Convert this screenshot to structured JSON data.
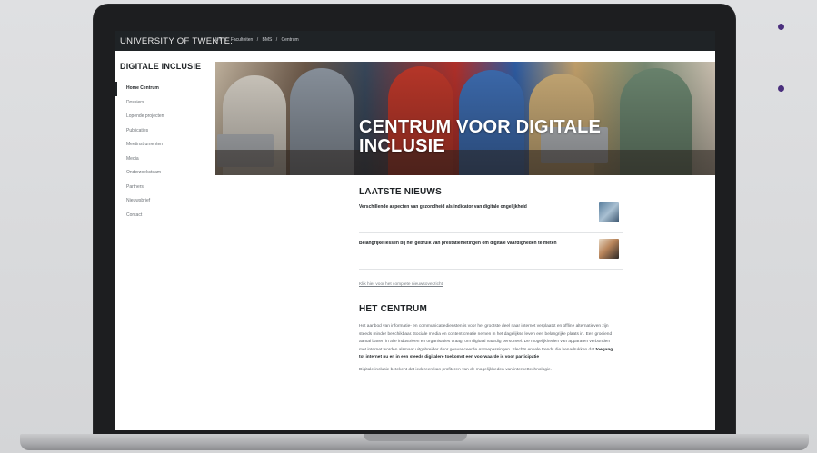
{
  "site": {
    "brand": "UNIVERSITY OF TWENTE.",
    "breadcrumbs": [
      "UT",
      "/",
      "Faculteiten",
      "/",
      "BMS",
      "/",
      "Centrum"
    ]
  },
  "sidebar": {
    "title": "DIGITALE INCLUSIE",
    "items": [
      {
        "label": "Home Centrum"
      },
      {
        "label": "Dossiers"
      },
      {
        "label": "Lopende projecten"
      },
      {
        "label": "Publicaties"
      },
      {
        "label": "Meetinstrumenten"
      },
      {
        "label": "Media"
      },
      {
        "label": "Onderzoeksteam"
      },
      {
        "label": "Partners"
      },
      {
        "label": "Nieuwsbrief"
      },
      {
        "label": "Contact"
      }
    ]
  },
  "hero": {
    "title_line1": "CENTRUM VOOR DIGITALE",
    "title_line2": "INCLUSIE"
  },
  "news": {
    "heading": "LAATSTE NIEUWS",
    "items": [
      {
        "title": "Verschillende aspecten van gezondheid als indicator van digitale ongelijkheid"
      },
      {
        "title": "Belangrijke lessen bij het gebruik van prestatiemetingen om digitale vaardigheden te meten"
      }
    ],
    "more_link": "Klik hier voor het complete nieuwsoverzicht"
  },
  "centre": {
    "heading": "HET CENTRUM",
    "para1": "Het aanbod van informatie- en communicatiediensten is voor het grootste deel naar internet verplaatst en offline alternatieven zijn steeds minder beschikbaar. Sociale media en content creatie nemen in het dagelijkse leven een belangrijke plaats in. Een groeiend aantal banen in alle industrieën en organisaties vraagt om digitaal vaardig personeel. De mogelijkheden van apparaten verbonden met internet worden alsmaar uitgebreider door geavanceerde AI-toepassingen. Slechts enkele trends die benadrukken dat",
    "para1_bold": "toegang tot internet nu en in een steeds digitalere toekomst een voorwaarde is voor participatie",
    "para2": "Digitale inclusie betekent dat iedereen kan profiteren van de mogelijkheden van internettechnologie."
  },
  "colors": {
    "topbar": "#1f2326",
    "accent_bullet": "#4a2f7d",
    "laptop_bezel": "#1d1e20"
  }
}
